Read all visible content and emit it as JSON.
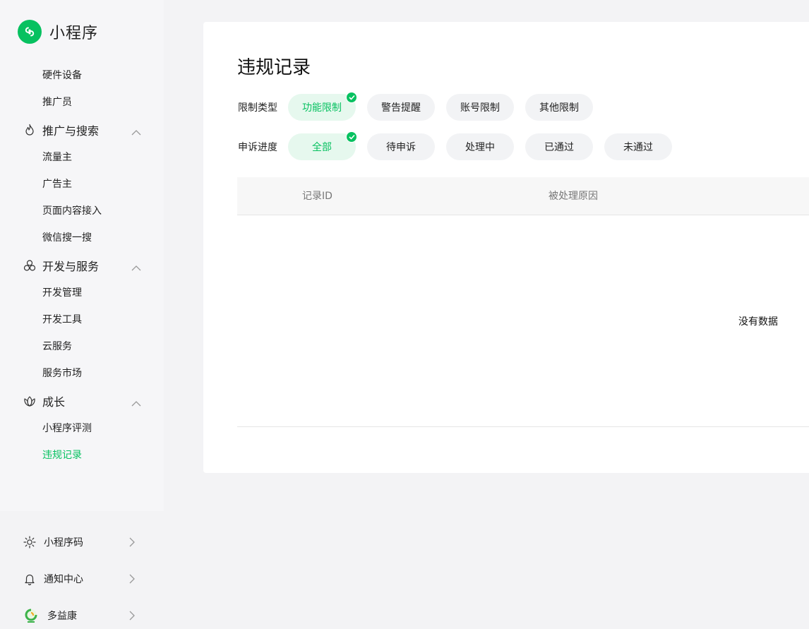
{
  "app": {
    "title": "小程序",
    "accent": "#07c160"
  },
  "sidebar": {
    "sections": [
      {
        "type": "sub",
        "label": "硬件设备"
      },
      {
        "type": "sub",
        "label": "推广员"
      },
      {
        "type": "group",
        "label": "推广与搜索",
        "icon": "flame-icon"
      },
      {
        "type": "sub",
        "label": "流量主"
      },
      {
        "type": "sub",
        "label": "广告主"
      },
      {
        "type": "sub",
        "label": "页面内容接入"
      },
      {
        "type": "sub",
        "label": "微信搜一搜"
      },
      {
        "type": "group",
        "label": "开发与服务",
        "icon": "circles-icon"
      },
      {
        "type": "sub",
        "label": "开发管理"
      },
      {
        "type": "sub",
        "label": "开发工具"
      },
      {
        "type": "sub",
        "label": "云服务"
      },
      {
        "type": "sub",
        "label": "服务市场"
      },
      {
        "type": "group",
        "label": "成长",
        "icon": "lotus-icon"
      },
      {
        "type": "sub",
        "label": "小程序评测"
      },
      {
        "type": "sub",
        "label": "违规记录",
        "active": true
      }
    ],
    "bottom": [
      {
        "label": "小程序码",
        "icon": "sun-burst-icon"
      },
      {
        "label": "通知中心",
        "icon": "bell-icon"
      },
      {
        "label": "多益康",
        "icon": "account-avatar-icon"
      }
    ]
  },
  "main": {
    "title": "违规记录",
    "filters": [
      {
        "label": "限制类型",
        "options": [
          "功能限制",
          "警告提醒",
          "账号限制",
          "其他限制"
        ],
        "selected": 0
      },
      {
        "label": "申诉进度",
        "options": [
          "全部",
          "待申诉",
          "处理中",
          "已通过",
          "未通过"
        ],
        "selected": 0
      }
    ],
    "table": {
      "columns": [
        "记录ID",
        "被处理原因"
      ],
      "empty_text": "没有数据"
    }
  }
}
